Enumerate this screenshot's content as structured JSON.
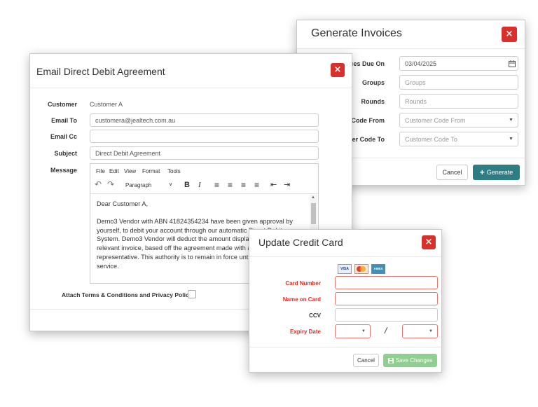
{
  "generate": {
    "title": "Generate Invoices",
    "close": "×",
    "labels": {
      "due_on": "ces Due On",
      "groups": "Groups",
      "rounds": "Rounds",
      "code_from": "Code From",
      "code_to": "ner Code To"
    },
    "due_on_value": "03/04/2025",
    "groups_placeholder": "Groups",
    "rounds_placeholder": "Rounds",
    "code_from_placeholder": "Customer Code From",
    "code_to_placeholder": "Customer Code To",
    "cancel": "Cancel",
    "generate": "Generate",
    "generate_icon": "+"
  },
  "email": {
    "title": "Email Direct Debit Agreement",
    "close": "×",
    "labels": {
      "customer": "Customer",
      "email_to": "Email To",
      "email_cc": "Email Cc",
      "subject": "Subject",
      "message": "Message"
    },
    "customer_value": "Customer A",
    "email_to_value": "customera@jealtech.com.au",
    "email_cc_value": "",
    "subject_value": "Direct Debit Agreement",
    "menu": [
      "File",
      "Edit",
      "View",
      "Format",
      "Tools"
    ],
    "format_select": "Paragraph",
    "toolbar": {
      "undo": "↶",
      "redo": "↷",
      "bold": "B",
      "italic": "I",
      "align_left": "≡",
      "align_center": "≡",
      "align_right": "≡",
      "justify": "≡",
      "outdent": "⇤",
      "indent": "⇥"
    },
    "body_lines": [
      "Dear Customer A,",
      "",
      "Demo3 Vendor with ABN 41824354234 have been given approval by",
      "yourself, to debit your account through our automatic Direct Debit",
      "System. Demo3 Vendor will deduct the amount displayed on each",
      "relevant invoice, based off the agreement made with a company",
      "representative. This authority is to remain in force until you cancel the",
      "service."
    ],
    "attach_label": "Attach Terms & Conditions and Privacy Policy"
  },
  "card": {
    "title": "Update Credit Card",
    "close": "×",
    "card_logos": [
      "VISA",
      "MC",
      "AMEX"
    ],
    "labels": {
      "number": "Card Number",
      "name": "Name on Card",
      "ccv": "CCV",
      "expiry": "Expiry Date"
    },
    "separator": "/",
    "cancel": "Cancel",
    "save": "Save Changes",
    "save_icon": "save-icon"
  },
  "colors": {
    "danger": "#d9302c",
    "teal": "#2e7d85",
    "save_green": "#8fcf8f"
  }
}
